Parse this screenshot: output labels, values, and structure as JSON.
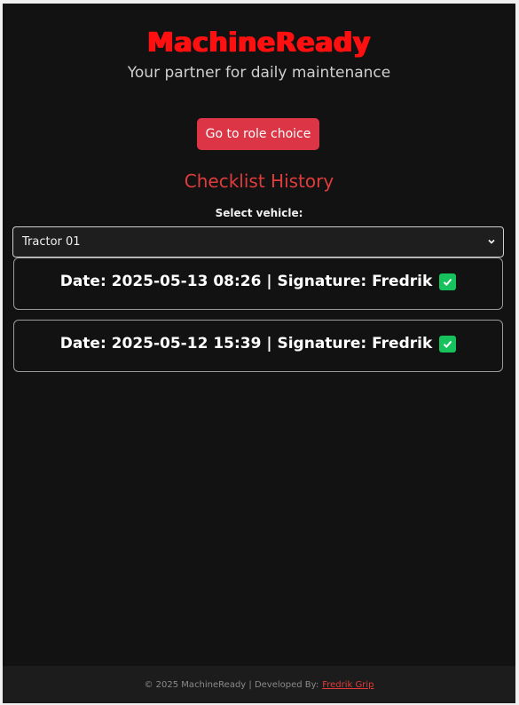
{
  "header": {
    "brand": "MachineReady",
    "tagline": "Your partner for daily maintenance"
  },
  "actions": {
    "role_button": "Go to role choice"
  },
  "history": {
    "title": "Checklist History",
    "select_label": "Select vehicle:",
    "selected_vehicle": "Tractor 01",
    "entries": [
      {
        "text": "Date: 2025-05-13 08:26 | Signature: Fredrik"
      },
      {
        "text": "Date: 2025-05-12 15:39 | Signature: Fredrik"
      }
    ]
  },
  "footer": {
    "text": "© 2025 MachineReady | Developed By:",
    "link": "Fredrik Grip"
  },
  "colors": {
    "brand": "#ff1010",
    "accent": "#dc3545",
    "check": "#16c25c",
    "background": "#121212"
  },
  "icons": {
    "entry_status": "check-mark-icon",
    "select_toggle": "chevron-down-icon"
  }
}
